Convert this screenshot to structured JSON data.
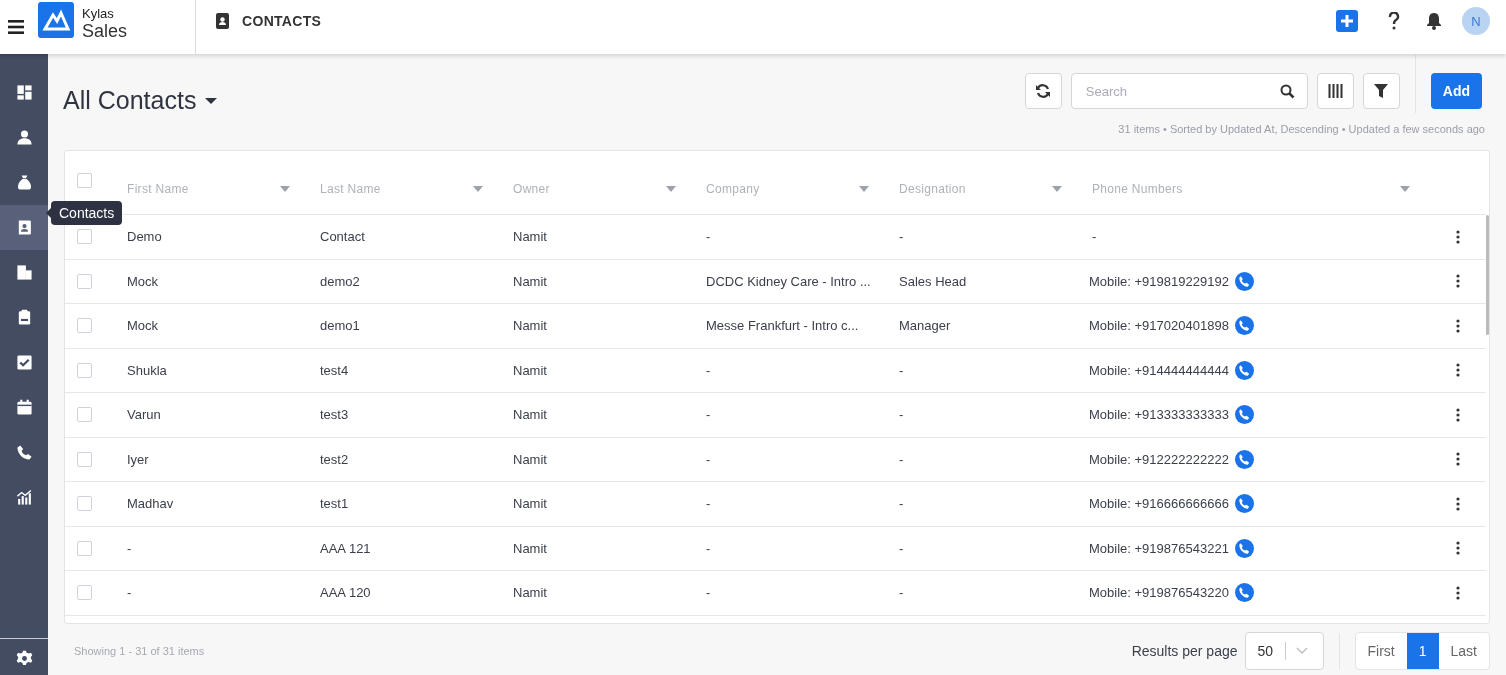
{
  "app": {
    "brand": "Kylas",
    "product": "Sales",
    "section": "CONTACTS",
    "avatar": "N"
  },
  "sidebar": {
    "items": [
      {
        "kind": "dashboard",
        "selected": false
      },
      {
        "kind": "person",
        "selected": false
      },
      {
        "kind": "moneybag",
        "selected": false
      },
      {
        "kind": "contacts",
        "selected": true
      },
      {
        "kind": "building",
        "selected": false
      },
      {
        "kind": "clipboard",
        "selected": false
      },
      {
        "kind": "task",
        "selected": false
      },
      {
        "kind": "calendar",
        "selected": false
      },
      {
        "kind": "phone",
        "selected": false
      },
      {
        "kind": "chart",
        "selected": false
      }
    ],
    "tooltip": "Contacts"
  },
  "list": {
    "title": "All Contacts",
    "search": {
      "placeholder": "Search"
    },
    "add_button": "Add",
    "meta": "31 items • Sorted by Updated At, Descending • Updated a few seconds ago"
  },
  "table": {
    "select_all": {
      "checked": false
    },
    "columns": [
      "First Name",
      "Last Name",
      "Owner",
      "Company",
      "Designation",
      "Phone Numbers"
    ],
    "rows": [
      {
        "checked": false,
        "cells": [
          "Demo",
          "Contact",
          "Namit",
          "-",
          "-",
          "-"
        ]
      },
      {
        "checked": false,
        "cells": [
          "Mock",
          "demo2",
          "Namit",
          "DCDC Kidney Care - Intro ...",
          "Sales Head",
          "Mobile: +919819229192"
        ]
      },
      {
        "checked": false,
        "cells": [
          "Mock",
          "demo1",
          "Namit",
          "Messe Frankfurt - Intro c...",
          "Manager",
          "Mobile: +917020401898"
        ]
      },
      {
        "checked": false,
        "cells": [
          "Shukla",
          "test4",
          "Namit",
          "-",
          "-",
          "Mobile: +914444444444"
        ]
      },
      {
        "checked": false,
        "cells": [
          "Varun",
          "test3",
          "Namit",
          "-",
          "-",
          "Mobile: +913333333333"
        ]
      },
      {
        "checked": false,
        "cells": [
          "Iyer",
          "test2",
          "Namit",
          "-",
          "-",
          "Mobile: +912222222222"
        ]
      },
      {
        "checked": false,
        "cells": [
          "Madhav",
          "test1",
          "Namit",
          "-",
          "-",
          "Mobile: +916666666666"
        ]
      },
      {
        "checked": false,
        "cells": [
          "-",
          "AAA 121",
          "Namit",
          "-",
          "-",
          "Mobile: +919876543221"
        ]
      },
      {
        "checked": false,
        "cells": [
          "-",
          "AAA 120",
          "Namit",
          "-",
          "-",
          "Mobile: +919876543220"
        ]
      }
    ]
  },
  "footer": {
    "summary": "Showing 1 - 31 of 31 items",
    "per_page_label": "Results per page",
    "per_page": "50",
    "pages": [
      {
        "label": "First",
        "selected": false
      },
      {
        "label": "1",
        "selected": true
      },
      {
        "label": "Last",
        "selected": false
      }
    ]
  }
}
